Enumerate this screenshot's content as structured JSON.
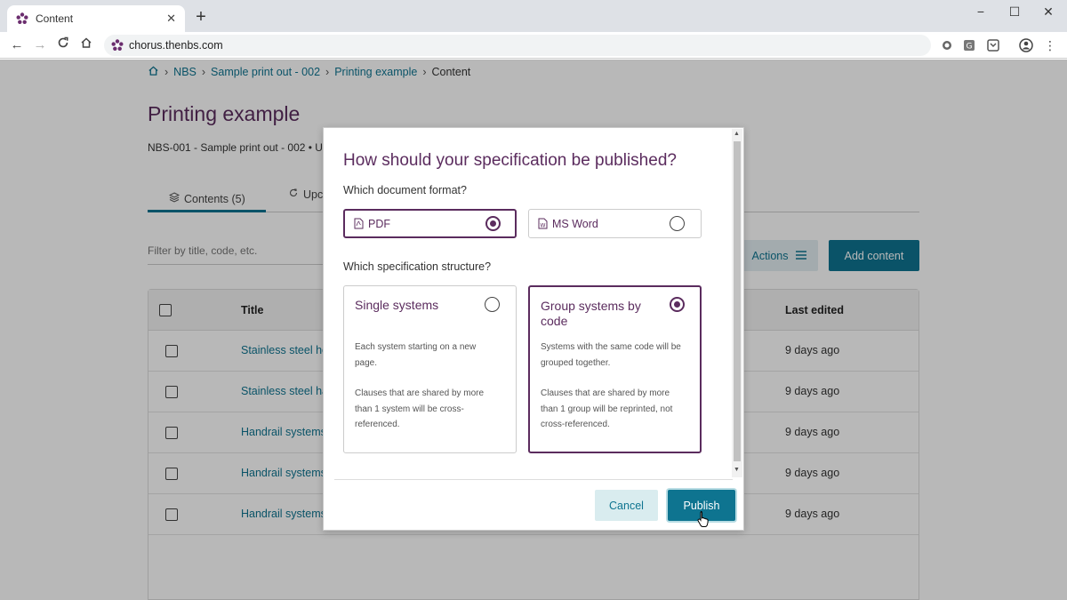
{
  "browser": {
    "tab_title": "Content",
    "new_tab": "+",
    "tab_close": "✕",
    "url": "chorus.thenbs.com",
    "window_controls": [
      "−",
      "☐",
      "✕"
    ]
  },
  "breadcrumb": {
    "items": [
      "NBS",
      "Sample print out - 002",
      "Printing example"
    ],
    "current": "Content"
  },
  "page": {
    "title": "Printing example",
    "subline": "NBS-001 - Sample print out - 002 • U",
    "tabs": [
      {
        "label": "Contents (5)",
        "icon": "layers-icon"
      },
      {
        "label": "Upc",
        "icon": "update-icon"
      }
    ],
    "filter_placeholder": "Filter by title, code, etc.",
    "actions_label": "Actions",
    "add_content_label": "Add content"
  },
  "table": {
    "headers": {
      "title": "Title",
      "last_edited": "Last edited"
    },
    "rows": [
      {
        "title": "Stainless steel he",
        "edited": "9 days ago"
      },
      {
        "title": "Stainless steel ha",
        "edited": "9 days ago"
      },
      {
        "title": "Handrail systems",
        "edited": "9 days ago"
      },
      {
        "title": "Handrail systems",
        "edited": "9 days ago"
      },
      {
        "title": "Handrail systems",
        "edited": "9 days ago"
      }
    ]
  },
  "modal": {
    "title": "How should your specification be published?",
    "format_question": "Which document format?",
    "formats": [
      {
        "label": "PDF",
        "selected": true
      },
      {
        "label": "MS Word",
        "selected": false
      }
    ],
    "structure_question": "Which specification structure?",
    "structures": [
      {
        "name": "Single systems",
        "selected": false,
        "desc1": "Each system starting on a new page.",
        "desc2": "Clauses that are shared by more than 1 system will be cross-referenced."
      },
      {
        "name": "Group systems by code",
        "selected": true,
        "desc1": "Systems with the same code will be grouped together.",
        "desc2": "Clauses that are shared by more than 1 group will be reprinted, not cross-referenced."
      }
    ],
    "cancel_label": "Cancel",
    "publish_label": "Publish"
  },
  "colors": {
    "brand_purple": "#5b2c5e",
    "accent_teal": "#0e7490"
  }
}
